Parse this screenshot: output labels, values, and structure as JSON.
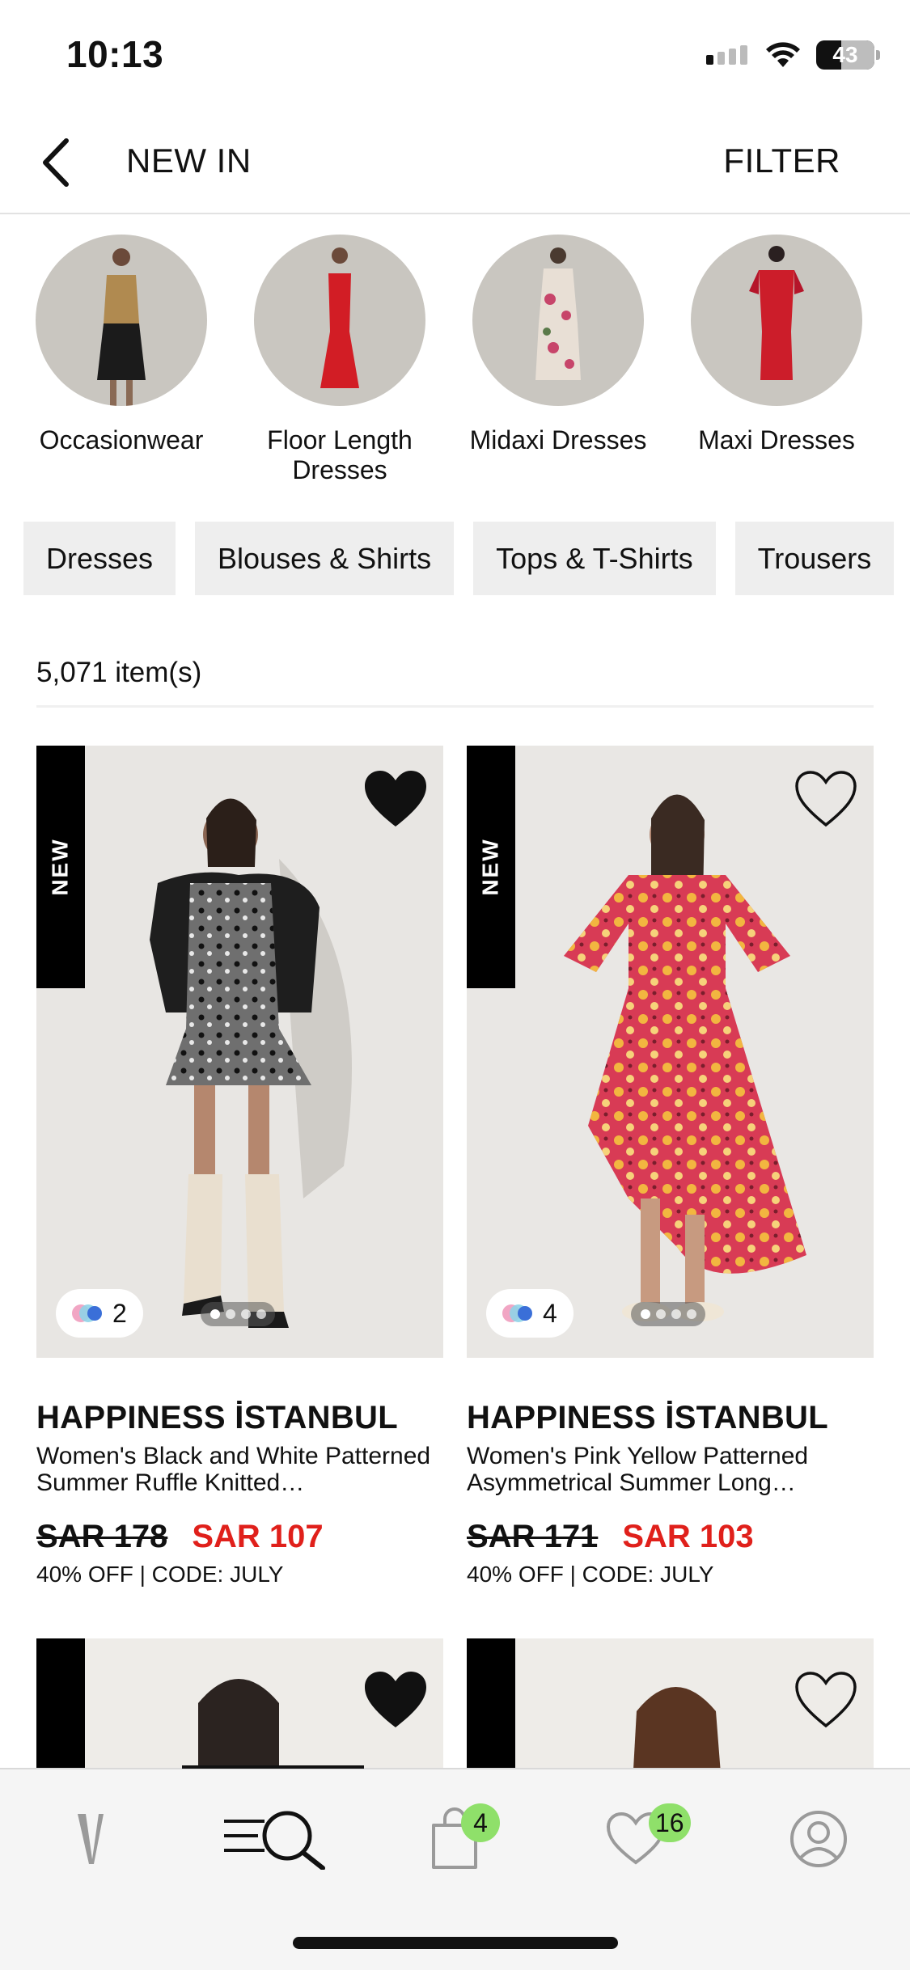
{
  "status_bar": {
    "time": "10:13",
    "battery": "43",
    "battery_level": 0.43
  },
  "header": {
    "title": "NEW IN",
    "filter_label": "FILTER"
  },
  "categories": [
    {
      "label": "Occasionwear",
      "colors": {
        "top": "#b08a50",
        "bottom": "#1b1b1b"
      }
    },
    {
      "label": "Floor Length Dresses",
      "colors": {
        "top": "#d21d25",
        "bottom": "#d21d25"
      }
    },
    {
      "label": "Midaxi Dresses",
      "colors": {
        "top": "#e8dfd5",
        "bottom": "#c7456a"
      }
    },
    {
      "label": "Maxi Dresses",
      "colors": {
        "top": "#cc1d2a",
        "bottom": "#b5152a"
      }
    }
  ],
  "chips": [
    "Dresses",
    "Blouses & Shirts",
    "Tops & T-Shirts",
    "Trousers"
  ],
  "item_count": "5,071 item(s)",
  "products": [
    {
      "badge": "NEW",
      "wishlisted": true,
      "color_count": "2",
      "brand": "HAPPINESS İSTANBUL",
      "name": "Women's Black and White Patterned Summer Ruffle Knitted…",
      "old_price": "SAR 178",
      "new_price": "SAR 107",
      "promo": "40% OFF | CODE: JULY",
      "image_index": 1,
      "image_count": 4
    },
    {
      "badge": "NEW",
      "wishlisted": false,
      "color_count": "4",
      "brand": "HAPPINESS İSTANBUL",
      "name": "Women's Pink Yellow Patterned Asymmetrical Summer Long…",
      "old_price": "SAR 171",
      "new_price": "SAR 103",
      "promo": "40% OFF | CODE: JULY",
      "image_index": 1,
      "image_count": 4
    }
  ],
  "tab_bar": {
    "tabs": [
      "home-logo-icon",
      "browse-search-icon",
      "bag-icon",
      "wishlist-icon",
      "account-icon"
    ],
    "active": "browse-search-icon",
    "bag_badge": "4",
    "wishlist_badge": "16"
  },
  "colors": {
    "sale": "#e0201b",
    "badge": "#8fe06a",
    "chip_bg": "#eeeeee"
  }
}
